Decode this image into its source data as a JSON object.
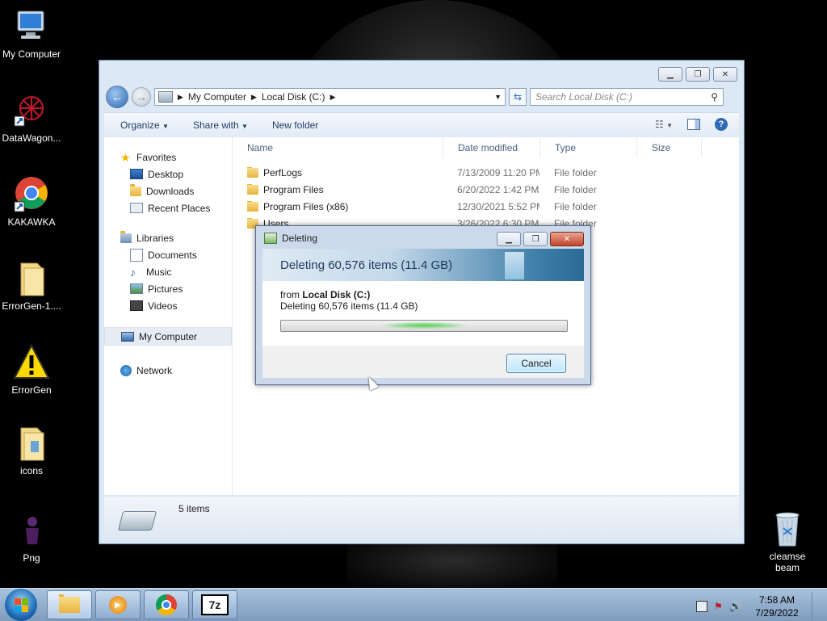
{
  "desktop": {
    "icons": [
      {
        "label": "My Computer",
        "icon": "computer-icon"
      },
      {
        "label": "DataWagon...",
        "icon": "datawagon-icon"
      },
      {
        "label": "KAKAWKA",
        "icon": "chrome-icon"
      },
      {
        "label": "ErrorGen-1....",
        "icon": "folder-icon"
      },
      {
        "label": "ErrorGen",
        "icon": "warning-icon"
      },
      {
        "label": "icons",
        "icon": "folder-icon"
      },
      {
        "label": "Png",
        "icon": "png-icon"
      }
    ],
    "recycle_label": "cleamse beam"
  },
  "explorer": {
    "breadcrumb": [
      "My Computer",
      "Local Disk (C:)"
    ],
    "search_placeholder": "Search Local Disk (C:)",
    "toolbar": {
      "organize": "Organize",
      "share_with": "Share with",
      "new_folder": "New folder"
    },
    "nav": {
      "favorites": "Favorites",
      "favorites_items": [
        "Desktop",
        "Downloads",
        "Recent Places"
      ],
      "libraries": "Libraries",
      "libraries_items": [
        "Documents",
        "Music",
        "Pictures",
        "Videos"
      ],
      "my_computer": "My Computer",
      "network": "Network"
    },
    "columns": {
      "name": "Name",
      "date": "Date modified",
      "type": "Type",
      "size": "Size"
    },
    "files": [
      {
        "name": "PerfLogs",
        "date": "7/13/2009 11:20 PM",
        "type": "File folder"
      },
      {
        "name": "Program Files",
        "date": "6/20/2022 1:42 PM",
        "type": "File folder"
      },
      {
        "name": "Program Files (x86)",
        "date": "12/30/2021 5:52 PM",
        "type": "File folder"
      },
      {
        "name": "Users",
        "date": "3/26/2022 6:30 PM",
        "type": "File folder"
      }
    ],
    "status": "5 items"
  },
  "dialog": {
    "title": "Deleting",
    "header": "Deleting 60,576 items (11.4 GB)",
    "from_prefix": "from",
    "from_location": "Local Disk (C:)",
    "detail": "Deleting 60,576 items (11.4 GB)",
    "cancel": "Cancel"
  },
  "taskbar": {
    "time": "7:58 AM",
    "date": "7/29/2022",
    "tasks": [
      "explorer-icon",
      "media-player-icon",
      "chrome-icon",
      "7zip-icon"
    ],
    "sevenzip_label": "7z"
  }
}
